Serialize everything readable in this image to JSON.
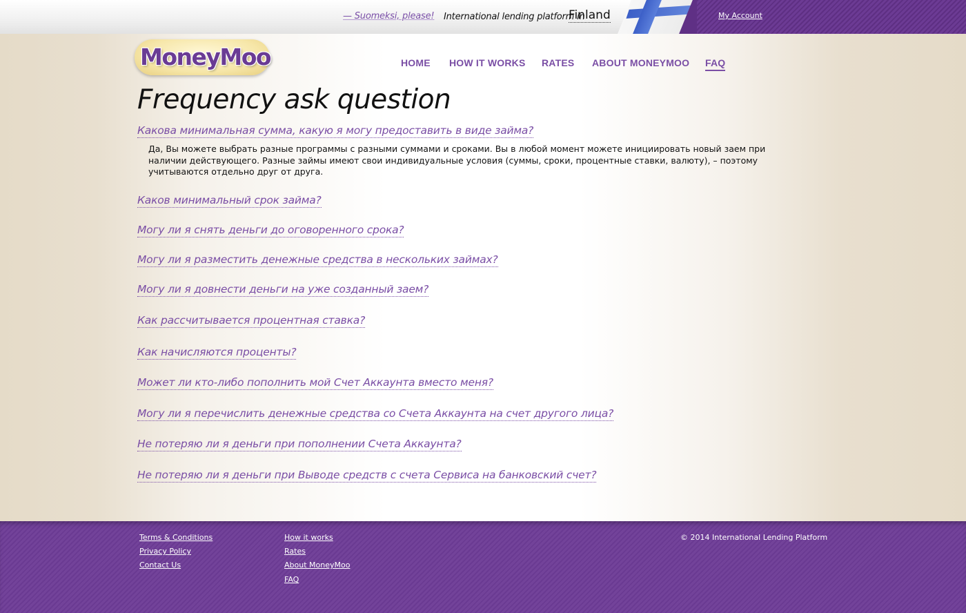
{
  "topbar": {
    "language_link": "— Suomeksi, please!",
    "platform_text": "International lending platform in",
    "country": "Finland",
    "account_link": "My Account"
  },
  "logo": {
    "text": "MoneyMoo"
  },
  "nav": {
    "items": [
      {
        "label": "HOME"
      },
      {
        "label": "HOW IT WORKS"
      },
      {
        "label": "RATES"
      },
      {
        "label": "ABOUT MONEYMOO"
      },
      {
        "label": "FAQ",
        "active": true
      }
    ]
  },
  "page": {
    "title": "Frequency ask question"
  },
  "faq": {
    "items": [
      {
        "question": "Какова минимальная сумма, какую я могу предоставить в виде займа?",
        "answer": "Да, Вы можете выбрать разные программы с разными суммами и сроками. Вы в любой момент можете инициировать новый заем при наличии действующего. Разные займы имеют свои индивидуальные условия (суммы, сроки, процентные ставки, валюту), – поэтому учитываются отдельно друг от друга."
      },
      {
        "question": "Каков минимальный срок займа?"
      },
      {
        "question": "Могу ли я снять деньги до оговоренного срока?"
      },
      {
        "question": "Могу ли я разместить денежные средства в нескольких займах?"
      },
      {
        "question": "Могу ли я довнести деньги на уже созданный заем?"
      },
      {
        "question": "Как рассчитывается процентная ставка?"
      },
      {
        "question": "Как начисляются проценты?"
      },
      {
        "question": "Может ли кто-либо пополнить мой Счет Аккаунта вместо меня?"
      },
      {
        "question": "Могу ли я перечислить денежные средства со Счета Аккаунта на счет другого лица?"
      },
      {
        "question": "Не потеряю ли я деньги при пополнении Счета Аккаунта?"
      },
      {
        "question": "Не потеряю ли я деньги при Выводе средств с счета Сервиса на банковский счет?"
      }
    ]
  },
  "footer": {
    "col1": [
      "Terms & Conditions",
      "Privacy Policy",
      "Contact Us"
    ],
    "col2": [
      "How it works",
      "Rates",
      "About MoneyMoo",
      "FAQ"
    ],
    "copyright": "© 2014  International Lending Platform"
  },
  "colors": {
    "accent": "#7a4ea5",
    "footer": "#6a3a92",
    "background": "#e6dcc9"
  }
}
